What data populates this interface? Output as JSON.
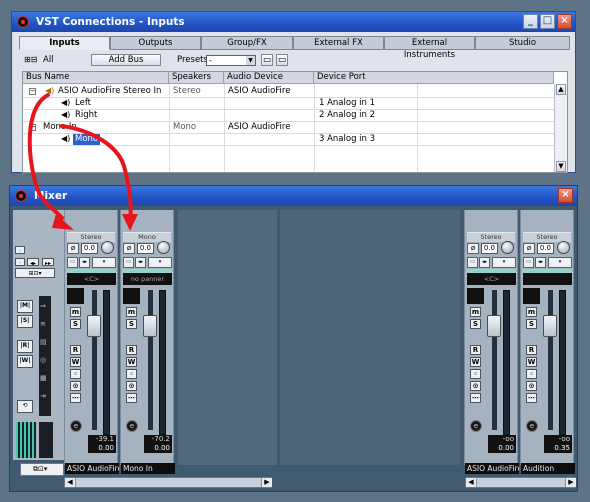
{
  "vst": {
    "title": "VST Connections - Inputs",
    "tabs": [
      "Inputs",
      "Outputs",
      "Group/FX",
      "External FX",
      "External Instruments",
      "Studio"
    ],
    "all_label": "All",
    "add_bus_label": "Add Bus",
    "presets_label": "Presets",
    "presets_value": "-",
    "columns": [
      "Bus Name",
      "Speakers",
      "Audio Device",
      "Device Port"
    ],
    "rows": [
      {
        "name": "ASIO AudioFire Stereo In",
        "speakers": "Stereo",
        "device": "ASIO AudioFire",
        "port": ""
      },
      {
        "name": "Left",
        "speakers": "",
        "device": "",
        "port": "1 Analog in 1"
      },
      {
        "name": "Right",
        "speakers": "",
        "device": "",
        "port": "2 Analog in 2"
      },
      {
        "name": "Mono In",
        "speakers": "Mono",
        "device": "ASIO AudioFire",
        "port": ""
      },
      {
        "name": "Mono",
        "speakers": "",
        "device": "",
        "port": "3 Analog in 3"
      }
    ]
  },
  "mixer": {
    "title": "Mixer",
    "channels": [
      {
        "type": "Stereo",
        "gain": "0.0",
        "name": "ASIO AudioFire",
        "pan": "<C>",
        "peak": "-39.1",
        "level": "0.00"
      },
      {
        "type": "Mono",
        "gain": "0.0",
        "name": "Mono In",
        "pan": "no panner",
        "peak": "-70.2",
        "level": "0.00"
      },
      {
        "type": "Stereo",
        "gain": "0.0",
        "name": "ASIO AudioFire",
        "pan": "<C>",
        "peak": "-oo",
        "level": "0.00"
      },
      {
        "type": "Stereo",
        "gain": "0.0",
        "name": "Audition",
        "pan": "",
        "peak": "-oo",
        "level": "0.35"
      }
    ],
    "buttons": {
      "m": "m",
      "s": "S",
      "r": "R",
      "w": "W",
      "e": "e"
    },
    "left_labels": {
      "ab1": "|M|",
      "ab2": "|S|",
      "ab3": "|R|",
      "ab4": "|W|"
    }
  },
  "colors": {
    "title_bar": "#2153c4",
    "annotation_arrow": "#e8141c",
    "mixer_bg": "#405a70"
  }
}
